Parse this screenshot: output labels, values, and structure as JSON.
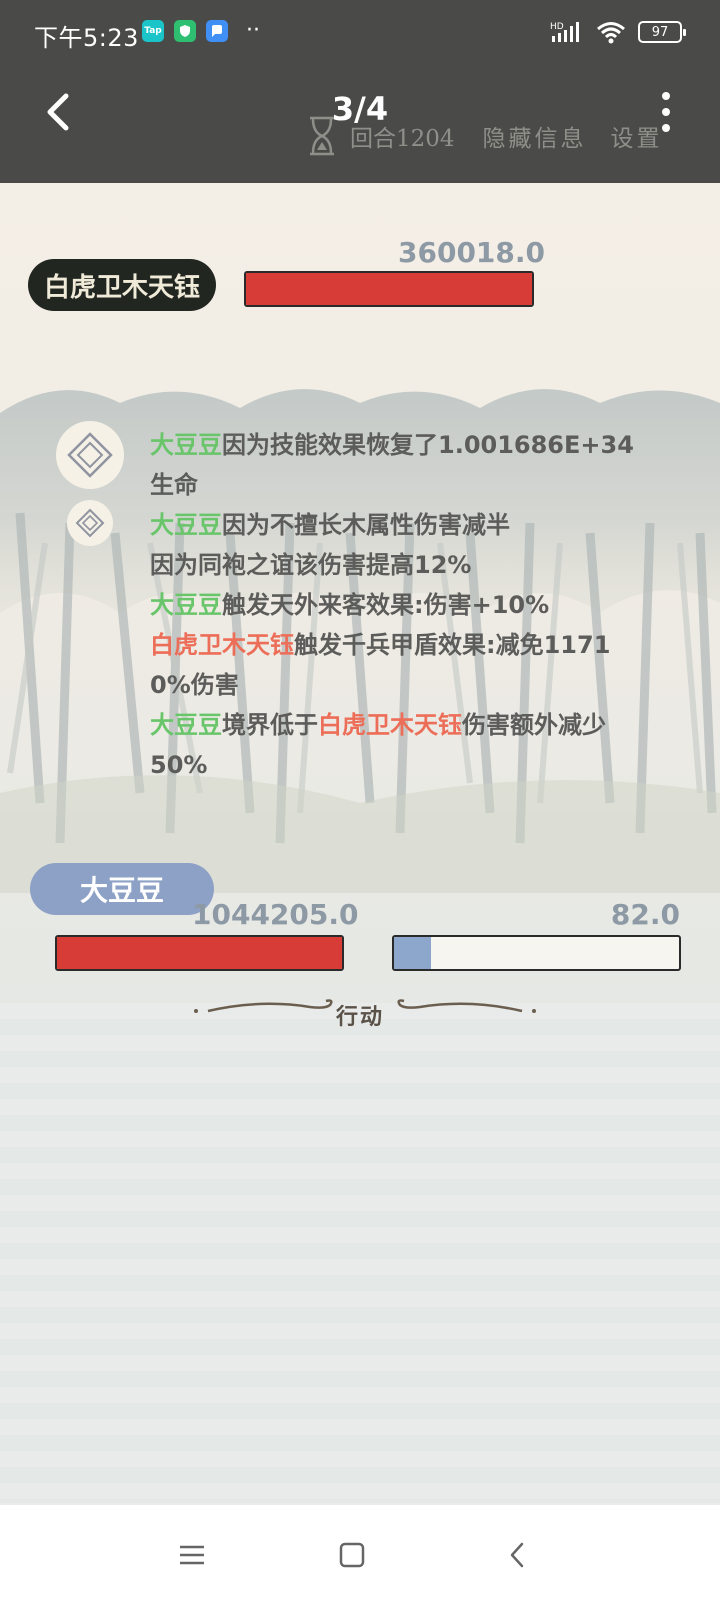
{
  "status_bar": {
    "time": "下午5:23",
    "app_icons": [
      {
        "name": "taptap",
        "label": "Tap",
        "color": "#1bc4c8"
      },
      {
        "name": "shield",
        "label": "",
        "color": "#2fbf71"
      },
      {
        "name": "chat",
        "label": "",
        "color": "#3f8ff5"
      }
    ],
    "more_dots": "··",
    "battery": "97",
    "network": "HD"
  },
  "header": {
    "page_indicator": "3/4"
  },
  "game_top": {
    "round": "回合1204",
    "hide_info": "隐藏信息",
    "settings": "设置"
  },
  "enemy": {
    "name": "白虎卫木天钰",
    "hp_text": "360018.0",
    "hp_fraction": 1.0
  },
  "battle_log": {
    "lines": [
      {
        "segments": [
          {
            "text": "大豆豆",
            "color": "green"
          },
          {
            "text": "因为技能效果恢复了1.001686E+34",
            "color": "gray"
          }
        ]
      },
      {
        "segments": [
          {
            "text": "生命",
            "color": "gray"
          }
        ]
      },
      {
        "segments": [
          {
            "text": "大豆豆",
            "color": "green"
          },
          {
            "text": "因为不擅长木属性伤害减半",
            "color": "gray"
          }
        ]
      },
      {
        "segments": [
          {
            "text": "因为同袍之谊该伤害提高12%",
            "color": "gray"
          }
        ]
      },
      {
        "segments": [
          {
            "text": "大豆豆",
            "color": "green"
          },
          {
            "text": "触发天外来客效果:伤害+10%",
            "color": "gray"
          }
        ]
      },
      {
        "segments": [
          {
            "text": "白虎卫木天钰",
            "color": "red"
          },
          {
            "text": "触发千兵甲盾效果:减免1171",
            "color": "gray"
          }
        ]
      },
      {
        "segments": [
          {
            "text": "0%伤害",
            "color": "gray"
          }
        ]
      },
      {
        "segments": [
          {
            "text": "大豆豆",
            "color": "green"
          },
          {
            "text": "境界低于",
            "color": "gray"
          },
          {
            "text": "白虎卫木天钰",
            "color": "red"
          },
          {
            "text": "伤害额外减少",
            "color": "gray"
          }
        ]
      },
      {
        "segments": [
          {
            "text": "50%",
            "color": "gray"
          }
        ]
      }
    ]
  },
  "player": {
    "name": "大豆豆",
    "hp_text": "1044205.0",
    "hp_fraction": 1.0,
    "energy_text": "82.0",
    "energy_fraction": 0.13
  },
  "action_label": "行动",
  "colors": {
    "header_bg": "#4a4a48",
    "hp_red": "#d83c37",
    "energy_blue": "#8ca6cc",
    "player_name_green": "#69c56a",
    "enemy_name_red": "#ec6e58"
  }
}
